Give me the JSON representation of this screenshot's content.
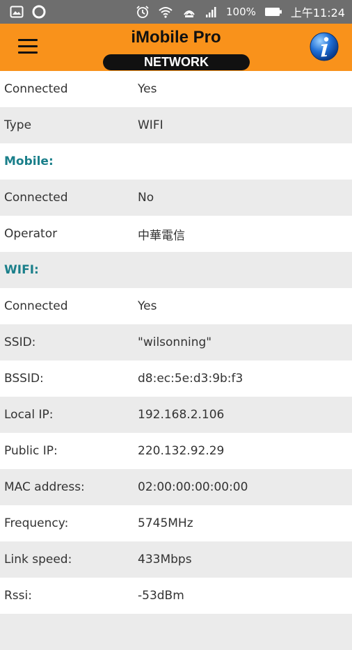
{
  "status_bar": {
    "icons_left": [
      "image-icon",
      "circle-icon"
    ],
    "icons_right": [
      "alarm-icon",
      "wifi-icon",
      "hotspot-icon",
      "signal-icon",
      "battery-icon"
    ],
    "battery": "100%",
    "time": "上午11:24"
  },
  "app_bar": {
    "title": "iMobile Pro",
    "section": "NETWORK",
    "menu_icon": "hamburger-menu-icon",
    "info_icon": "info-icon"
  },
  "rows": [
    {
      "label": "Connected",
      "value": "Yes"
    },
    {
      "label": "Type",
      "value": "WIFI"
    },
    {
      "label": "Mobile:",
      "value": ""
    },
    {
      "label": "Connected",
      "value": "No"
    },
    {
      "label": "Operator",
      "value": "中華電信"
    },
    {
      "label": "WIFI:",
      "value": ""
    },
    {
      "label": "Connected",
      "value": "Yes"
    },
    {
      "label": "SSID:",
      "value": "\"wilsonning\""
    },
    {
      "label": "BSSID:",
      "value": "d8:ec:5e:d3:9b:f3"
    },
    {
      "label": "Local IP:",
      "value": "192.168.2.106"
    },
    {
      "label": "Public IP:",
      "value": "220.132.92.29"
    },
    {
      "label": "MAC address:",
      "value": "02:00:00:00:00:00"
    },
    {
      "label": "Frequency:",
      "value": "5745MHz"
    },
    {
      "label": "Link speed:",
      "value": "433Mbps"
    },
    {
      "label": "Rssi:",
      "value": "-53dBm"
    },
    {
      "label": "",
      "value": ""
    }
  ],
  "colors": {
    "app_bar": "#f9921b",
    "status_bar": "#6e6e6e",
    "section_header": "#1a7f8a",
    "row_alt": "#ebebeb"
  }
}
